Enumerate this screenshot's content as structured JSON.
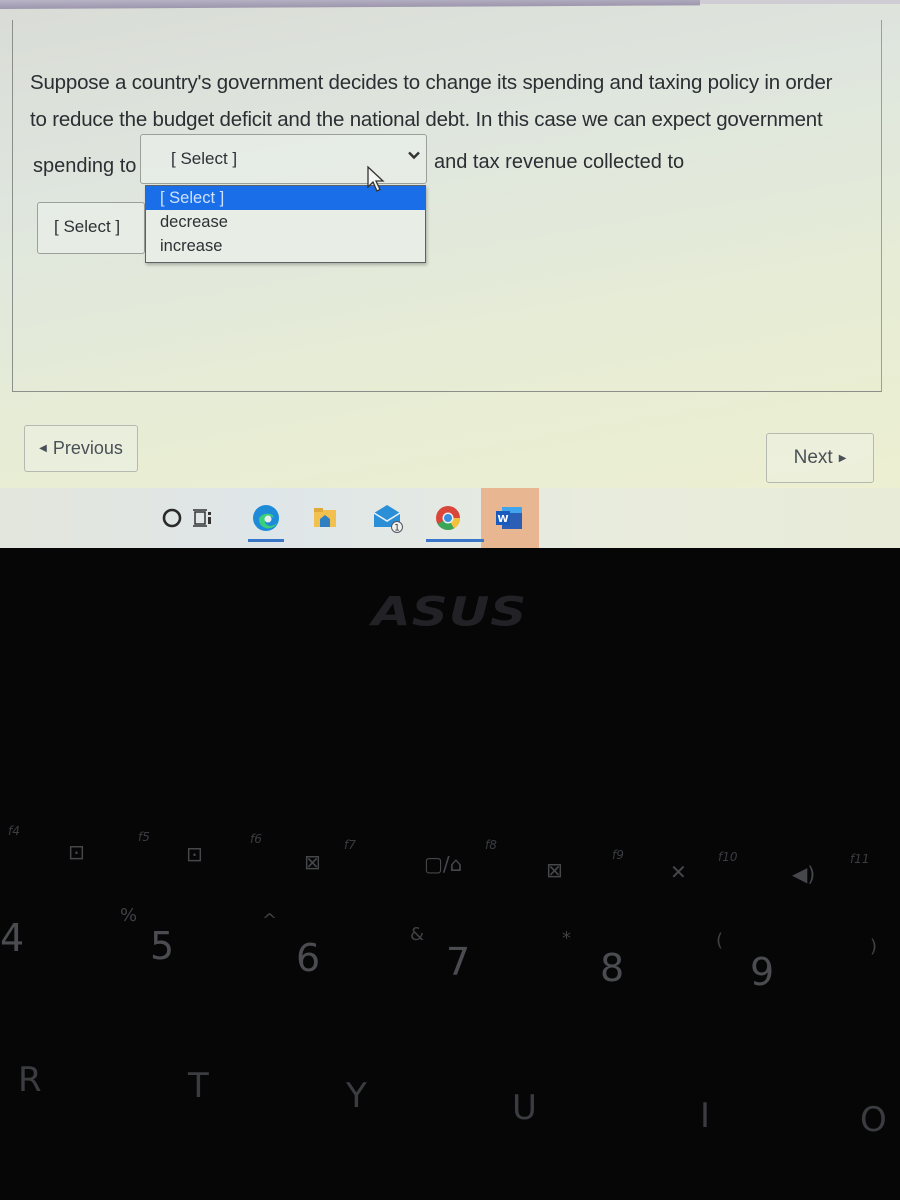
{
  "question": {
    "text_line1": "Suppose a country's government decides to change its spending and taxing policy in order",
    "text_line2": "to reduce the budget deficit and the national debt.  In this case we can expect government",
    "before_select1": "spending to",
    "after_select1": "and tax revenue collected to"
  },
  "select1": {
    "value": "[ Select ]",
    "expanded": true,
    "options": [
      "[ Select ]",
      "decrease",
      "increase"
    ],
    "highlighted_option": "[ Select ]"
  },
  "select2": {
    "value": "[ Select ]"
  },
  "navigation": {
    "previous_label": "Previous",
    "next_label": "Next"
  },
  "taskbar": {
    "icons": [
      "search-icon",
      "task-view-icon",
      "edge-icon",
      "file-explorer-icon",
      "mail-icon",
      "chrome-icon",
      "word-icon"
    ],
    "mail_badge": "1",
    "word_letter": "W"
  },
  "colors": {
    "highlight": "#1a6ee8",
    "text": "#2b2f33",
    "word_active": "#e8b791"
  },
  "laptop": {
    "brand": "ASUS",
    "function_keys": [
      "f4",
      "f5",
      "f6",
      "f7",
      "f8",
      "f9",
      "f10",
      "f11"
    ],
    "symbol_keys": [
      "%",
      "^",
      "&",
      "*",
      "(",
      ")"
    ],
    "number_keys": [
      "4",
      "5",
      "6",
      "7",
      "8",
      "9"
    ],
    "letter_keys": [
      "R",
      "T",
      "Y",
      "U",
      "I",
      "O"
    ]
  }
}
